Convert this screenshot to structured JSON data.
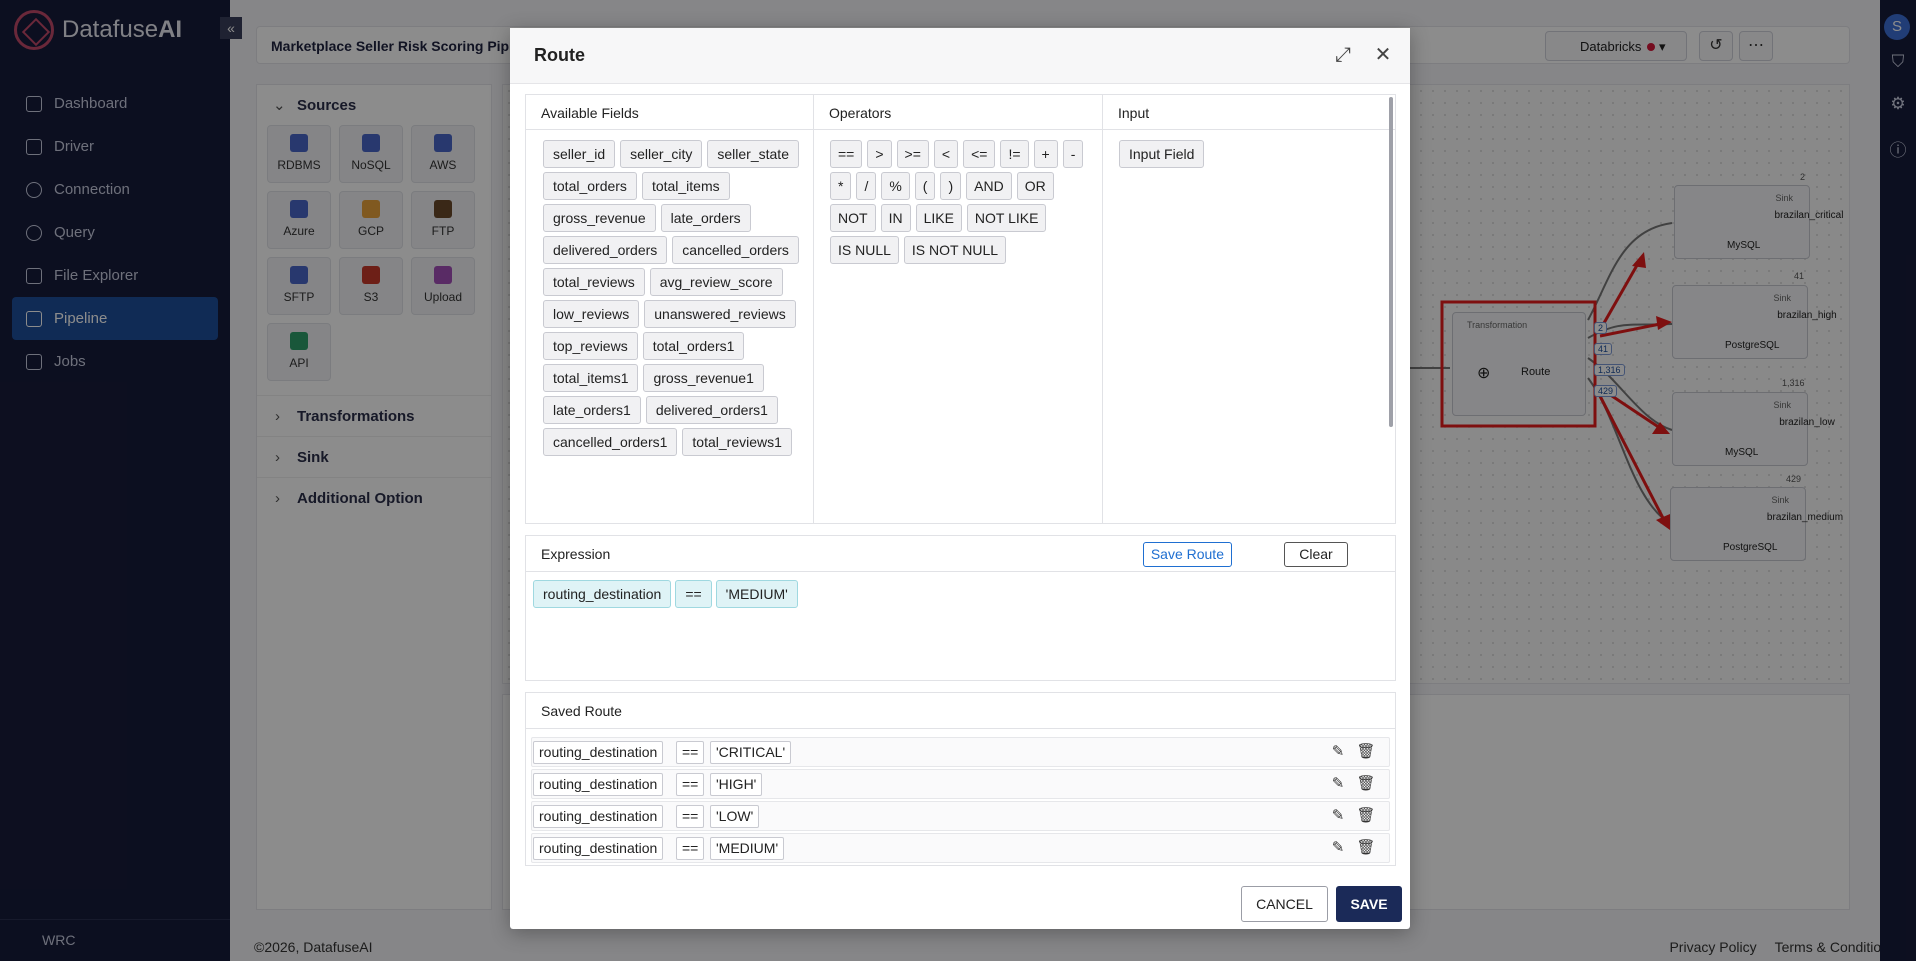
{
  "app": {
    "brand_light": "Datafuse",
    "brand_bold": "AI",
    "collapse_glyph": "«",
    "footer_label": "WRC"
  },
  "nav": [
    {
      "label": "Dashboard",
      "icon": "dashboard-icon"
    },
    {
      "label": "Driver",
      "icon": "driver-icon"
    },
    {
      "label": "Connection",
      "icon": "connection-icon"
    },
    {
      "label": "Query",
      "icon": "query-icon"
    },
    {
      "label": "File Explorer",
      "icon": "file-explorer-icon"
    },
    {
      "label": "Pipeline",
      "icon": "pipeline-icon",
      "active": true
    },
    {
      "label": "Jobs",
      "icon": "jobs-icon"
    }
  ],
  "header": {
    "pipeline_title": "Marketplace Seller Risk Scoring Pip",
    "engine": "Databricks",
    "engine_status_color": "#d5173a"
  },
  "left_panel": {
    "sources_title": "Sources",
    "tiles": [
      "RDBMS",
      "NoSQL",
      "AWS",
      "Azure",
      "GCP",
      "FTP",
      "SFTP",
      "S3",
      "Upload",
      "API"
    ],
    "sections": [
      "Transformations",
      "Sink",
      "Additional Option"
    ]
  },
  "graph": {
    "transformation_tag": "Transformation",
    "route_label": "Route",
    "route_counts": [
      "2",
      "41",
      "1,316",
      "429"
    ],
    "sinks": [
      {
        "name": "brazilan_critical",
        "db": "MySQL",
        "count": "2"
      },
      {
        "name": "brazilan_high",
        "db": "PostgreSQL",
        "count": "41"
      },
      {
        "name": "brazilan_low",
        "db": "MySQL",
        "count": "1,316"
      },
      {
        "name": "brazilan_medium",
        "db": "PostgreSQL",
        "count": "429"
      }
    ],
    "sink_tag": "Sink",
    "highlight_color": "#e51c1c"
  },
  "footer": {
    "copyright": "©2026, DatafuseAI",
    "links": [
      "Privacy Policy",
      "Terms & Conditions"
    ]
  },
  "user": {
    "avatar_initial": "S"
  },
  "modal": {
    "title": "Route",
    "available_fields_title": "Available Fields",
    "operators_title": "Operators",
    "input_title": "Input",
    "fields": [
      "seller_id",
      "seller_city",
      "seller_state",
      "total_orders",
      "total_items",
      "gross_revenue",
      "late_orders",
      "delivered_orders",
      "cancelled_orders",
      "total_reviews",
      "avg_review_score",
      "low_reviews",
      "unanswered_reviews",
      "top_reviews",
      "total_orders1",
      "total_items1",
      "gross_revenue1",
      "late_orders1",
      "delivered_orders1",
      "cancelled_orders1",
      "total_reviews1"
    ],
    "operators": [
      "==",
      ">",
      ">=",
      "<",
      "<=",
      "!=",
      "+",
      "-",
      "*",
      "/",
      "%",
      "(",
      ")",
      "AND",
      "OR",
      "NOT",
      "IN",
      "LIKE",
      "NOT LIKE",
      "IS NULL",
      "IS NOT NULL"
    ],
    "input_chip": "Input Field",
    "expression_title": "Expression",
    "save_route_label": "Save Route",
    "clear_label": "Clear",
    "expression": [
      "routing_destination",
      "==",
      "'MEDIUM'"
    ],
    "saved_title": "Saved Route",
    "saved_routes": [
      {
        "field": "routing_destination",
        "op": "==",
        "value": "'CRITICAL'"
      },
      {
        "field": "routing_destination",
        "op": "==",
        "value": "'HIGH'"
      },
      {
        "field": "routing_destination",
        "op": "==",
        "value": "'LOW'"
      },
      {
        "field": "routing_destination",
        "op": "==",
        "value": "'MEDIUM'"
      }
    ],
    "cancel_label": "CANCEL",
    "save_label": "SAVE"
  }
}
